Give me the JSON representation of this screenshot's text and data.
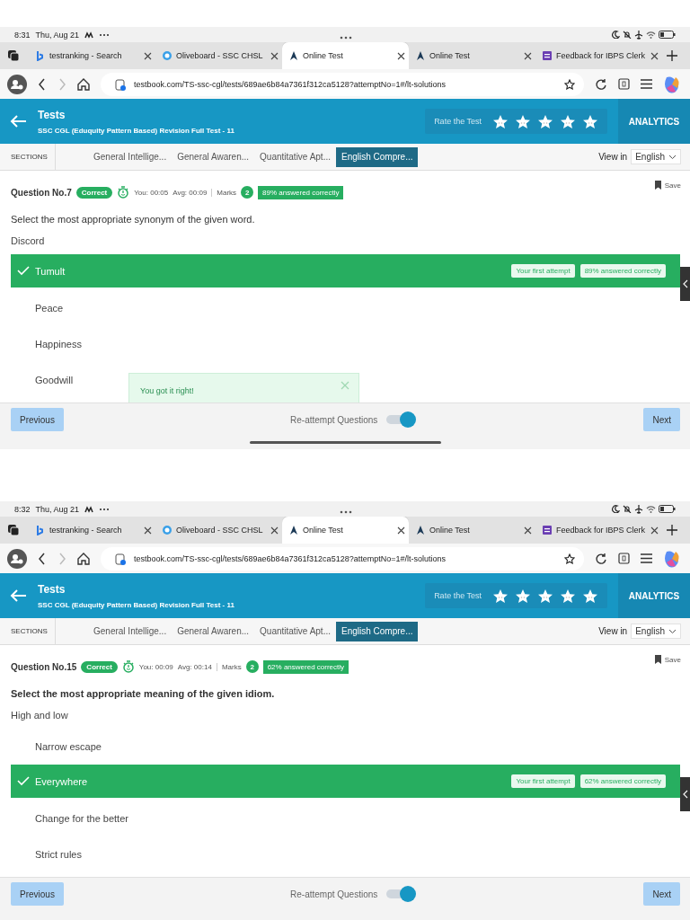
{
  "screens": [
    {
      "status_bar": {
        "time": "8:31",
        "date": "Thu, Aug 21"
      },
      "tabs": [
        {
          "title": "testranking - Search",
          "selected": false,
          "kind": "search"
        },
        {
          "title": "Oliveboard - SSC CHSL",
          "selected": false,
          "kind": "bubble"
        },
        {
          "title": "Online Test",
          "selected": true,
          "kind": "book"
        },
        {
          "title": "Online Test",
          "selected": false,
          "kind": "book"
        },
        {
          "title": "Feedback for IBPS Clerk",
          "selected": false,
          "kind": "form"
        }
      ],
      "address": "testbook.com/TS-ssc-cgl/tests/689ae6b84a7361f312ca5128?attemptNo=1#/lt-solutions",
      "header": {
        "title": "Tests",
        "subtitle": "SSC CGL (Eduquity Pattern Based) Revision Full Test - 11",
        "rate_label": "Rate the Test",
        "action": "ANALYTICS"
      },
      "sections": {
        "label": "SECTIONS",
        "items": [
          {
            "label": "General Intellige...",
            "selected": false
          },
          {
            "label": "General Awaren...",
            "selected": false
          },
          {
            "label": "Quantitative Apt...",
            "selected": false
          },
          {
            "label": "English Compre...",
            "selected": true
          }
        ],
        "view_label": "View in",
        "language": "English"
      },
      "question": {
        "number": "Question No.7",
        "status": "Correct",
        "you": "You: 00:05",
        "avg": "Avg: 00:09",
        "marks_label": "Marks",
        "marks": "2",
        "answered": "89% answered correctly",
        "save": "Save"
      },
      "prompt": {
        "text": "Select the most appropriate synonym of the given word.",
        "bold": false
      },
      "word": "Discord",
      "options": [
        {
          "label": "Tumult",
          "selected": true,
          "badges": [
            "Your first attempt",
            "89% answered correctly"
          ]
        },
        {
          "label": "Peace",
          "selected": false
        },
        {
          "label": "Happiness",
          "selected": false
        },
        {
          "label": "Goodwill",
          "selected": false
        }
      ],
      "toast": "You got it right!",
      "footer": {
        "previous": "Previous",
        "toggle_label": "Re-attempt Questions",
        "toggle_on": true,
        "next": "Next"
      }
    },
    {
      "status_bar": {
        "time": "8:32",
        "date": "Thu, Aug 21"
      },
      "tabs": [
        {
          "title": "testranking - Search",
          "selected": false,
          "kind": "search"
        },
        {
          "title": "Oliveboard - SSC CHSL",
          "selected": false,
          "kind": "bubble"
        },
        {
          "title": "Online Test",
          "selected": true,
          "kind": "book"
        },
        {
          "title": "Online Test",
          "selected": false,
          "kind": "book"
        },
        {
          "title": "Feedback for IBPS Clerk",
          "selected": false,
          "kind": "form"
        }
      ],
      "address": "testbook.com/TS-ssc-cgl/tests/689ae6b84a7361f312ca5128?attemptNo=1#/lt-solutions",
      "header": {
        "title": "Tests",
        "subtitle": "SSC CGL (Eduquity Pattern Based) Revision Full Test - 11",
        "rate_label": "Rate the Test",
        "action": "ANALYTICS"
      },
      "sections": {
        "label": "SECTIONS",
        "items": [
          {
            "label": "General Intellige...",
            "selected": false
          },
          {
            "label": "General Awaren...",
            "selected": false
          },
          {
            "label": "Quantitative Apt...",
            "selected": false
          },
          {
            "label": "English Compre...",
            "selected": true
          }
        ],
        "view_label": "View in",
        "language": "English"
      },
      "question": {
        "number": "Question No.15",
        "status": "Correct",
        "you": "You: 00:09",
        "avg": "Avg: 00:14",
        "marks_label": "Marks",
        "marks": "2",
        "answered": "62% answered correctly",
        "save": "Save"
      },
      "prompt": {
        "text": "Select the most appropriate meaning of the given idiom.",
        "bold": true
      },
      "word": "High and low",
      "options": [
        {
          "label": "Narrow escape",
          "selected": false
        },
        {
          "label": "Everywhere",
          "selected": true,
          "badges": [
            "Your first attempt",
            "62% answered correctly"
          ]
        },
        {
          "label": "Change for the better",
          "selected": false
        },
        {
          "label": "Strict rules",
          "selected": false
        }
      ],
      "footer": {
        "previous": "Previous",
        "toggle_label": "Re-attempt Questions",
        "toggle_on": true,
        "next": "Next"
      }
    }
  ]
}
